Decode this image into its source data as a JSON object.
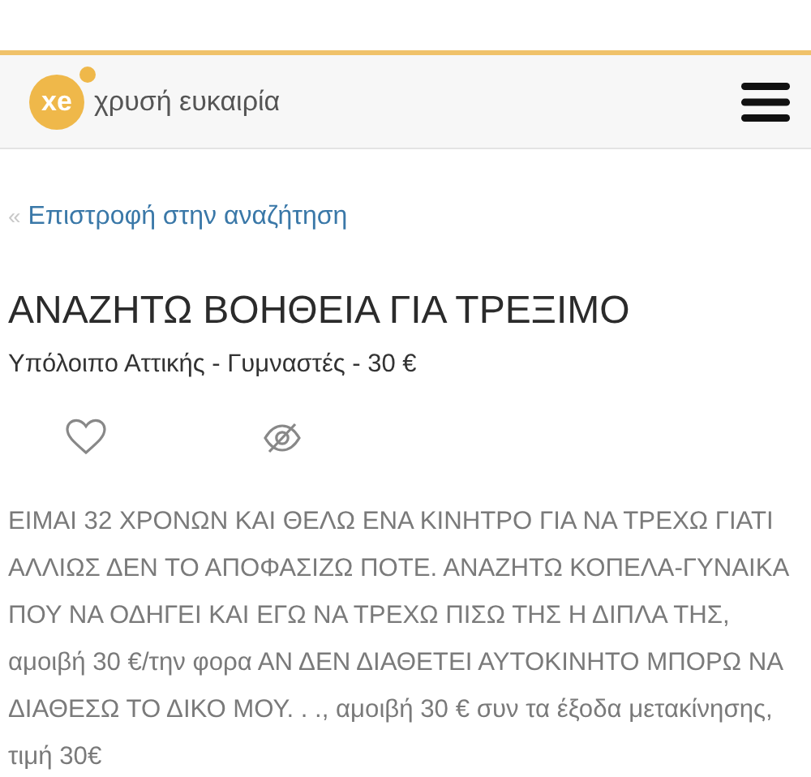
{
  "header": {
    "logo_mark": "xe",
    "logo_text": "χρυσή ευκαιρία"
  },
  "back_link": {
    "icon": "«",
    "label": "Επιστροφή στην αναζήτηση"
  },
  "listing": {
    "title": "ΑΝΑΖΗΤΩ ΒΟΗΘΕΙΑ ΓΙΑ ΤΡΕΞΙΜΟ",
    "subtitle": "Υπόλοιπο Αττικής - Γυμναστές - 30 €",
    "description": "ΕΙΜΑΙ 32 ΧΡΟΝΩΝ ΚΑΙ ΘΕΛΩ ΕΝΑ ΚΙΝΗΤΡΟ ΓΙΑ ΝΑ ΤΡΕΧΩ ΓΙΑΤΙ ΑΛΛΙΩΣ ΔΕΝ ΤΟ ΑΠΟΦΑΣΙΖΩ ΠΟΤΕ. ΑΝΑΖΗΤΩ ΚΟΠΕΛΑ-ΓΥΝΑΙΚΑ ΠΟΥ ΝΑ ΟΔΗΓΕΙ ΚΑΙ ΕΓΩ ΝΑ ΤΡΕΧΩ ΠΙΣΩ ΤΗΣ Η ΔΙΠΛΑ ΤΗΣ, αμοιβή 30 €/την φορα ΑΝ ΔΕΝ ΔΙΑΘΕΤΕΙ ΑΥΤΟΚΙΝΗΤΟ ΜΠΟΡΩ ΝΑ ΔΙΑΘΕΣΩ ΤΟ ΔΙΚΟ ΜΟΥ. . ., αμοιβή 30 € συν τα έξοδα μετακίνησης, τιμή 30€"
  }
}
